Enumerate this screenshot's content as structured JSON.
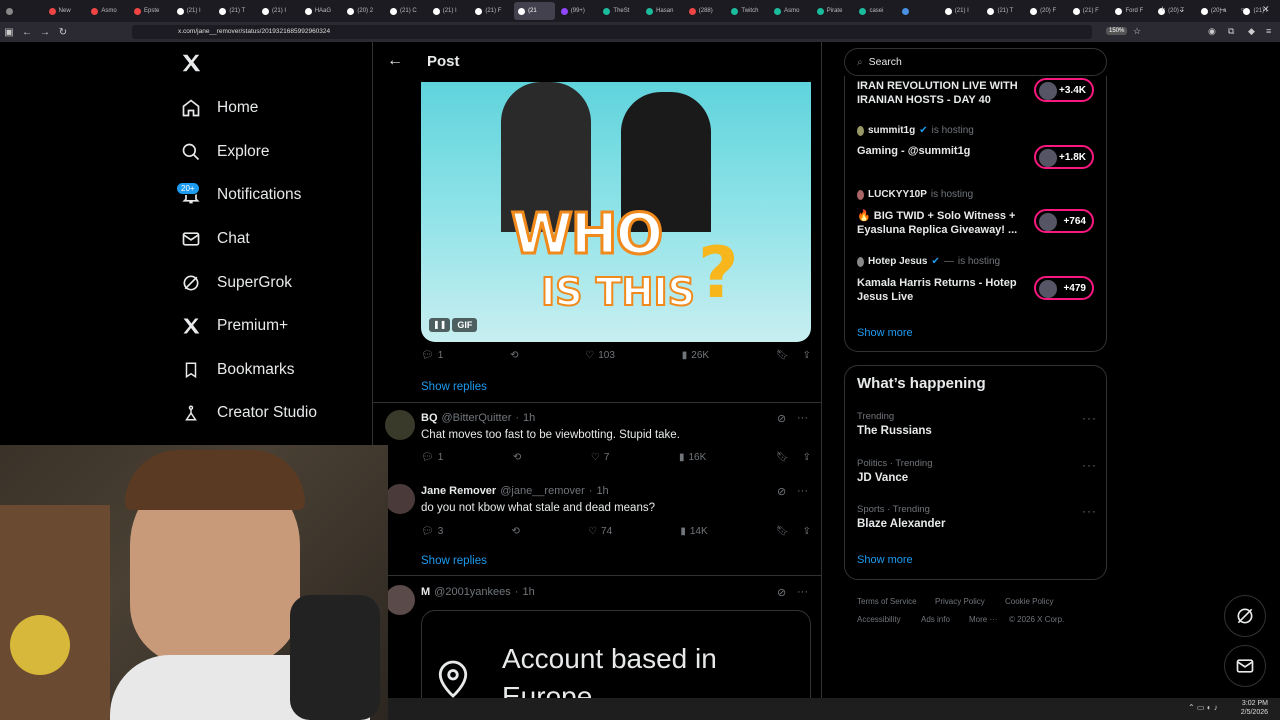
{
  "browser": {
    "tabs": [
      {
        "label": "",
        "color": "#888"
      },
      {
        "label": "New",
        "color": "#e44"
      },
      {
        "label": "Asmo",
        "color": "#e44"
      },
      {
        "label": "Epste",
        "color": "#e44"
      },
      {
        "label": "(21) I",
        "color": "#fff"
      },
      {
        "label": "(21) T",
        "color": "#fff"
      },
      {
        "label": "(21) I",
        "color": "#fff"
      },
      {
        "label": "HAaG",
        "color": "#fff"
      },
      {
        "label": "(20) 2",
        "color": "#fff"
      },
      {
        "label": "(21) C",
        "color": "#fff"
      },
      {
        "label": "(21) I",
        "color": "#fff"
      },
      {
        "label": "(21) F",
        "color": "#fff"
      },
      {
        "label": "(21",
        "color": "#fff",
        "active": true
      },
      {
        "label": "(99+)",
        "color": "#9146ff"
      },
      {
        "label": "TheSt",
        "color": "#1abc9c"
      },
      {
        "label": "Hasan",
        "color": "#1abc9c"
      },
      {
        "label": "(288)",
        "color": "#e44"
      },
      {
        "label": "Twitch",
        "color": "#1abc9c"
      },
      {
        "label": "Asmo",
        "color": "#1abc9c"
      },
      {
        "label": "Pirate",
        "color": "#1abc9c"
      },
      {
        "label": "casei",
        "color": "#1abc9c"
      },
      {
        "label": "",
        "color": "#4a90e2"
      },
      {
        "label": "(21) I",
        "color": "#fff"
      },
      {
        "label": "(21) T",
        "color": "#fff"
      },
      {
        "label": "(20) F",
        "color": "#fff"
      },
      {
        "label": "(21) F",
        "color": "#fff"
      },
      {
        "label": "Ford F",
        "color": "#fff"
      },
      {
        "label": "(20) T",
        "color": "#fff"
      },
      {
        "label": "(20) a",
        "color": "#fff"
      },
      {
        "label": "(21) I",
        "color": "#fff"
      }
    ],
    "url": "x.com/jane__remover/status/2019321685992960324",
    "zoom": "150%"
  },
  "nav": {
    "logo": "X",
    "items": [
      {
        "label": "Home",
        "icon": "home-icon"
      },
      {
        "label": "Explore",
        "icon": "search-icon"
      },
      {
        "label": "Notifications",
        "icon": "bell-icon"
      },
      {
        "label": "Chat",
        "icon": "mail-icon"
      },
      {
        "label": "SuperGrok",
        "icon": "grok-icon"
      },
      {
        "label": "Premium+",
        "icon": "x-icon"
      },
      {
        "label": "Bookmarks",
        "icon": "bookmark-icon"
      },
      {
        "label": "Creator Studio",
        "icon": "creator-icon"
      }
    ],
    "notif_badge": "20+"
  },
  "header": {
    "title": "Post"
  },
  "gif": {
    "text_line1": "WHO",
    "text_line2": "IS THIS",
    "badge": "GIF"
  },
  "main_post_stats": {
    "replies": "1",
    "likes": "103",
    "views": "26K"
  },
  "show_replies_1": "Show replies",
  "replies": [
    {
      "name": "BQ",
      "handle": "@BitterQuitter",
      "time": "1h",
      "text": "Chat moves too fast to be viewbotting. Stupid take.",
      "replies": "1",
      "likes": "7",
      "views": "16K"
    },
    {
      "name": "Jane Remover",
      "handle": "@jane__remover",
      "time": "1h",
      "text": "do you not kbow what stale and dead means?",
      "replies": "3",
      "likes": "74",
      "views": "14K"
    },
    {
      "name": "M",
      "handle": "@2001yankees",
      "time": "1h",
      "card_text_1": "Account based in",
      "card_text_2": "Europe"
    }
  ],
  "show_replies_2": "Show replies",
  "search": {
    "placeholder": "Search"
  },
  "live": [
    {
      "title": "IRAN REVOLUTION LIVE WITH IRANIAN HOSTS - DAY 40",
      "count": "+3.4K"
    },
    {
      "host": "summit1g",
      "hosting": "is hosting",
      "title": "Gaming - @summit1g",
      "count": "+1.8K"
    },
    {
      "host": "LUCKYY10P",
      "hosting": "is hosting",
      "title": "🔥 BIG TWID + Solo Witness + Eyasluna Replica Giveaway! ...",
      "count": "+764"
    },
    {
      "host": "Hotep Jesus",
      "hosting": "is hosting",
      "title": "Kamala Harris Returns - Hotep Jesus Live",
      "count": "+479"
    }
  ],
  "show_more_1": "Show more",
  "happening": {
    "title": "What’s happening",
    "trends": [
      {
        "context": "Trending",
        "name": "The Russians"
      },
      {
        "context": "Politics · Trending",
        "name": "JD Vance"
      },
      {
        "context": "Sports · Trending",
        "name": "Blaze Alexander"
      }
    ],
    "show_more": "Show more"
  },
  "footer": {
    "links": [
      "Terms of Service",
      "Privacy Policy",
      "Cookie Policy",
      "Accessibility",
      "Ads info",
      "More ···"
    ],
    "copyright": "© 2026 X Corp."
  },
  "taskbar": {
    "time": "3:02 PM",
    "date": "2/5/2026"
  },
  "colors": {
    "accent": "#1d9bf0",
    "live": "#f91880",
    "bg": "#000000",
    "border": "#2f3336"
  }
}
